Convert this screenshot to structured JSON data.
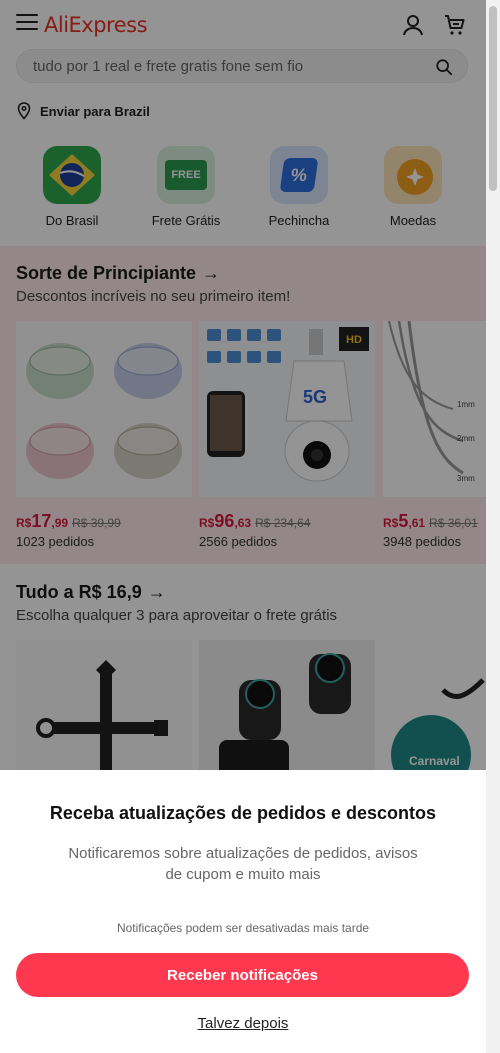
{
  "header": {
    "logo": "AliExpress",
    "search_placeholder": "tudo por 1 real e frete gratis fone sem fio"
  },
  "shipping": {
    "label": "Enviar para Brazil"
  },
  "tiles": [
    {
      "label": "Do Brasil",
      "icon": "brazil-flag-icon"
    },
    {
      "label": "Frete Grátis",
      "icon": "free-shipping-icon",
      "badge": "FREE"
    },
    {
      "label": "Pechincha",
      "icon": "percent-tag-icon",
      "badge": "%"
    },
    {
      "label": "Moedas",
      "icon": "coin-icon"
    }
  ],
  "section1": {
    "title": "Sorte de Principiante",
    "subtitle": "Descontos incríveis no seu primeiro item!",
    "products": [
      {
        "currency": "R$",
        "price_int": "17",
        "price_dec": ",99",
        "old_price": "R$ 39,99",
        "orders": "1023 pedidos"
      },
      {
        "currency": "R$",
        "price_int": "96",
        "price_dec": ",63",
        "old_price": "R$ 234,64",
        "orders": "2566 pedidos"
      },
      {
        "currency": "R$",
        "price_int": "5",
        "price_dec": ",61",
        "old_price": "R$ 36,01",
        "orders": "3948 pedidos"
      }
    ],
    "product2_label": "5G",
    "product2_badge": "HD",
    "product3_sizes": [
      "1mm",
      "2mm",
      "3mm"
    ]
  },
  "section2": {
    "title": "Tudo a R$ 16,9",
    "subtitle": "Escolha qualquer 3 para aproveitar o frete grátis",
    "product3_label": "Carnaval"
  },
  "sheet": {
    "title": "Receba atualizações de pedidos e descontos",
    "description": "Notificaremos sobre atualizações de pedidos, avisos de cupom e muito mais",
    "note": "Notificações podem ser desativadas mais tarde",
    "primary_button": "Receber notificações",
    "secondary_link": "Talvez depois"
  },
  "colors": {
    "brand": "#e43225",
    "price": "#d71a3f",
    "button": "#fd384f",
    "section_bg": "#ffe9ec"
  }
}
